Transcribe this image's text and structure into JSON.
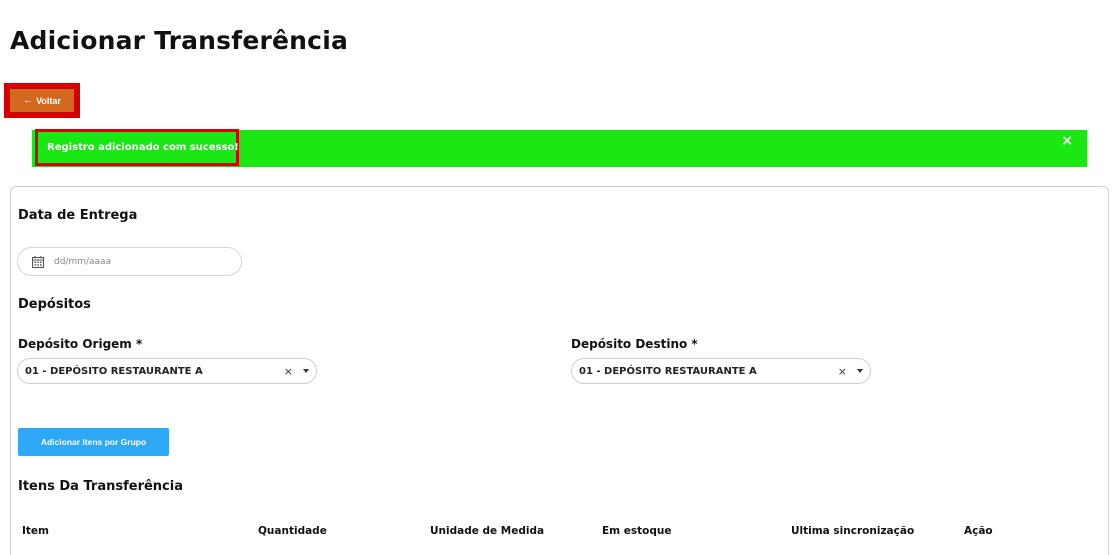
{
  "page": {
    "title": "Adicionar Transferência"
  },
  "toolbar": {
    "back_label": "Voltar"
  },
  "alert": {
    "message": "Registro adicionado com sucesso!",
    "close": "×"
  },
  "form": {
    "delivery_section": "Data de Entrega",
    "date_placeholder": "dd/mm/aaaa",
    "deposits_section": "Depósitos",
    "origin_label": "Depósito Origem *",
    "origin_value": "01 - DEPÓSITO RESTAURANTE A",
    "destination_label": "Depósito Destino *",
    "destination_value": "01 - DEPÓSITO RESTAURANTE A",
    "clear_symbol": "×",
    "add_group_label": "Adicionar Itens por Grupo",
    "items_section": "Itens Da Transferência"
  },
  "table": {
    "columns": [
      "Item",
      "Quantidade",
      "Unidade de Medida",
      "Em estoque",
      "Ultima sincronização",
      "Ação"
    ]
  },
  "colors": {
    "back_button": "#d2691e",
    "highlight_border": "#d40000",
    "success_alert": "#1ae815",
    "primary_button": "#2ea8f5"
  }
}
